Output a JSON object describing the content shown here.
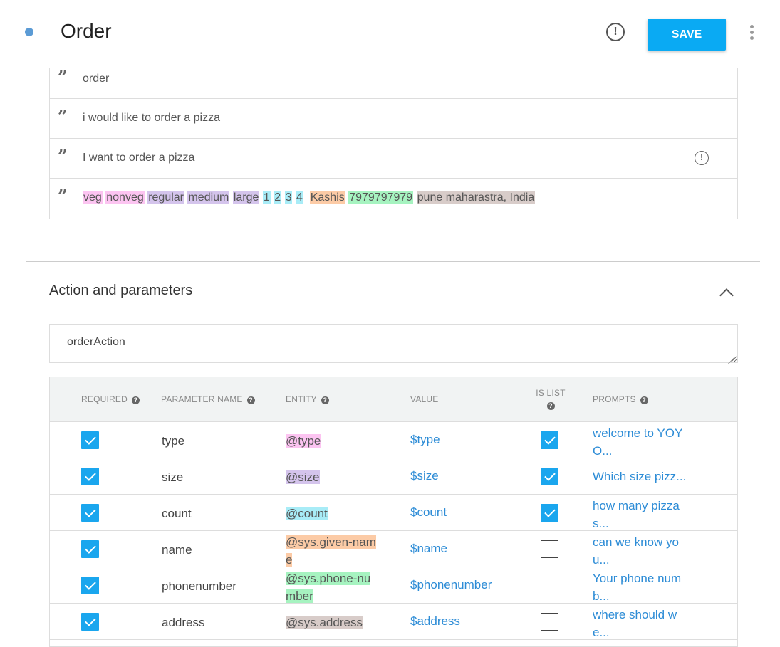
{
  "header": {
    "title": "Order",
    "save_label": "SAVE"
  },
  "colors": {
    "accent": "#0aaaf3",
    "link": "#2d8cd6",
    "pink": "#fcc4f1",
    "purple": "#d4c4ec",
    "cyan": "#a8ecf7",
    "orange": "#fccba6",
    "green": "#a6f3c0",
    "tan": "#d8ccc9"
  },
  "phrases": [
    {
      "segments": [
        {
          "text": "order",
          "color": ""
        }
      ]
    },
    {
      "segments": [
        {
          "text": "i would like to order a pizza",
          "color": ""
        }
      ]
    },
    {
      "segments": [
        {
          "text": "I want to order a pizza",
          "color": ""
        }
      ],
      "alert": true
    },
    {
      "segments": [
        {
          "text": "veg",
          "color": "#fcc4f1"
        },
        {
          "text": " ",
          "color": ""
        },
        {
          "text": "nonveg",
          "color": "#fcc4f1"
        },
        {
          "text": " ",
          "color": ""
        },
        {
          "text": "regular",
          "color": "#d4c4ec"
        },
        {
          "text": " ",
          "color": ""
        },
        {
          "text": "medium",
          "color": "#d4c4ec"
        },
        {
          "text": " ",
          "color": ""
        },
        {
          "text": "large",
          "color": "#d4c4ec"
        },
        {
          "text": " ",
          "color": ""
        },
        {
          "text": "1",
          "color": "#a8ecf7"
        },
        {
          "text": " ",
          "color": ""
        },
        {
          "text": "2",
          "color": "#a8ecf7"
        },
        {
          "text": " ",
          "color": ""
        },
        {
          "text": "3",
          "color": "#a8ecf7"
        },
        {
          "text": " ",
          "color": ""
        },
        {
          "text": "4",
          "color": "#a8ecf7"
        },
        {
          "text": "  ",
          "color": ""
        },
        {
          "text": "Kashis",
          "color": "#fccba6"
        },
        {
          "text": " ",
          "color": ""
        },
        {
          "text": "7979797979",
          "color": "#a6f3c0"
        },
        {
          "text": " ",
          "color": ""
        },
        {
          "text": "pune maharastra, India",
          "color": "#d8ccc9"
        }
      ]
    }
  ],
  "section": {
    "title": "Action and parameters",
    "action_value": "orderAction"
  },
  "table": {
    "headers": {
      "required": "REQUIRED",
      "parameter_name": "PARAMETER NAME",
      "entity": "ENTITY",
      "value": "VALUE",
      "is_list_1": "IS LIST",
      "prompts": "PROMPTS"
    },
    "rows": [
      {
        "required": true,
        "name": "type",
        "entity": "@type",
        "entity_color": "#fcc4f1",
        "value": "$type",
        "is_list": true,
        "prompt": "welcome to YOY O..."
      },
      {
        "required": true,
        "name": "size",
        "entity": "@size",
        "entity_color": "#d4c4ec",
        "value": "$size",
        "is_list": true,
        "prompt": "Which size pizz..."
      },
      {
        "required": true,
        "name": "count",
        "entity": "@count",
        "entity_color": "#a8ecf7",
        "value": "$count",
        "is_list": true,
        "prompt": "how many pizza s..."
      },
      {
        "required": true,
        "name": "name",
        "entity": "@sys.given-name",
        "entity_color": "#fccba6",
        "value": "$name",
        "is_list": false,
        "prompt": "can we know yo u..."
      },
      {
        "required": true,
        "name": "phonenumber",
        "entity": "@sys.phone-number",
        "entity_color": "#a6f3c0",
        "value": "$phonenumber",
        "is_list": false,
        "prompt": "Your phone num b..."
      },
      {
        "required": true,
        "name": "address",
        "entity": "@sys.address",
        "entity_color": "#d8ccc9",
        "value": "$address",
        "is_list": false,
        "prompt": "where should w e..."
      }
    ]
  }
}
